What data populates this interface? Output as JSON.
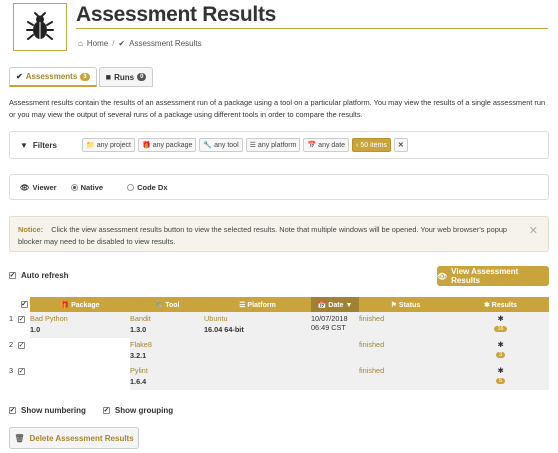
{
  "header": {
    "title": "Assessment Results"
  },
  "breadcrumb": {
    "home": "Home",
    "current": "Assessment Results"
  },
  "tabs": [
    {
      "label": "Assessments",
      "count": "3"
    },
    {
      "label": "Runs",
      "count": "0"
    }
  ],
  "description": "Assessment results contain the results of an assessment run of a package using a tool on a particular platform. You may view the results of a single assessment run or you may view the output of several runs of a package using different tools in order to compare the results.",
  "filters": {
    "label": "Filters",
    "project": "any project",
    "package": "any package",
    "tool": "any tool",
    "platform": "any platform",
    "date": "any date",
    "limit": "50 items"
  },
  "viewer": {
    "label": "Viewer",
    "native": "Native",
    "codedx": "Code Dx"
  },
  "notice": {
    "label": "Notice:",
    "text": "Click the view assessment results button to view the selected results. Note that multiple windows will be opened. Your web browser's popup blocker may need to be disabled to view results."
  },
  "auto_refresh": "Auto refresh",
  "view_button": "View Assessment Results",
  "table": {
    "headers": {
      "package": "Package",
      "tool": "Tool",
      "platform": "Platform",
      "date": "Date",
      "status": "Status",
      "results": "Results"
    },
    "rows": [
      {
        "num": "1",
        "package": "Bad Python",
        "package_version": "1.0",
        "tool": "Bandit",
        "tool_version": "1.3.0",
        "platform": "Ubuntu",
        "platform_version": "16.04 64-bit",
        "date": "10/07/2018",
        "time": "06:49 CST",
        "status": "finished",
        "results": "16"
      },
      {
        "num": "2",
        "package": "",
        "package_version": "",
        "tool": "Flake8",
        "tool_version": "3.2.1",
        "platform": "",
        "platform_version": "",
        "date": "",
        "time": "",
        "status": "finished",
        "results": "3"
      },
      {
        "num": "3",
        "package": "",
        "package_version": "",
        "tool": "Pylint",
        "tool_version": "1.6.4",
        "platform": "",
        "platform_version": "",
        "date": "",
        "time": "",
        "status": "finished",
        "results": "5"
      }
    ]
  },
  "show_numbering": "Show numbering",
  "show_grouping": "Show grouping",
  "delete_button": "Delete Assessment Results",
  "colors": {
    "accent": "#c9a43c",
    "accent_dark": "#a08232"
  }
}
